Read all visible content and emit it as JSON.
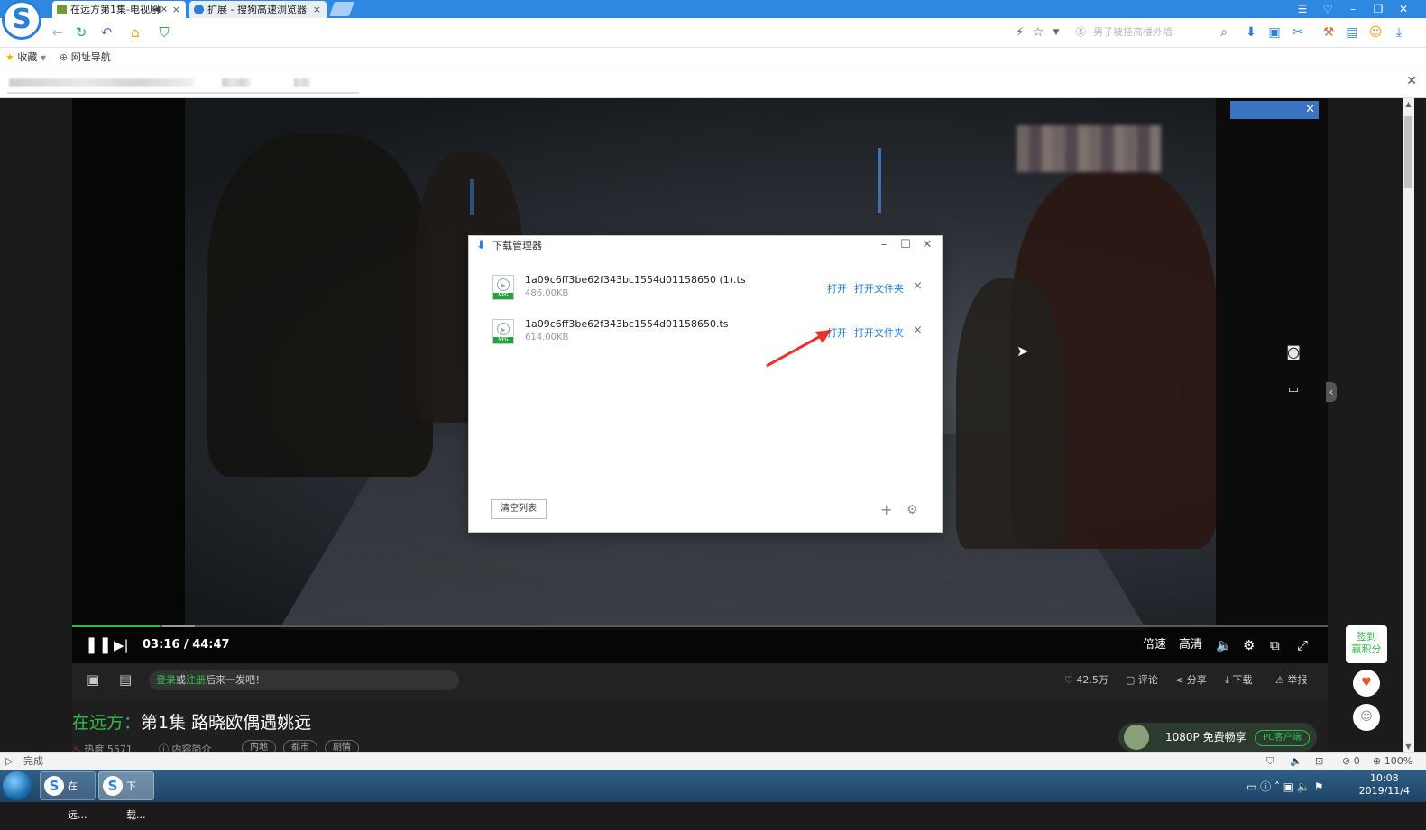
{
  "browser": {
    "logo_letter": "S",
    "tabs": [
      {
        "label": "在远方第1集-电视剧",
        "close": "×",
        "mute": "◀×"
      },
      {
        "label": "扩展 - 搜狗高速浏览器",
        "close": "×"
      }
    ],
    "window_controls": [
      "☰",
      "♡",
      "–",
      "❐",
      "✕"
    ],
    "address_placeholder": "男子被挂高楼外墙",
    "bookmarks": {
      "favorites": "收藏",
      "nav": "网址导航"
    },
    "infobar_close": "✕"
  },
  "video": {
    "ad_close": "✕",
    "progress_fraction": 0.07,
    "current_time": "03:16",
    "total_time": "44:47",
    "time_separator": "/",
    "controls": {
      "speed": "倍速",
      "quality": "高清"
    }
  },
  "toolbar": {
    "danmu_login": "登录",
    "danmu_or": "或",
    "danmu_register": "注册",
    "danmu_rest": "后来一发吧！",
    "likes": "42.5万",
    "comment": "评论",
    "share": "分享",
    "download": "下载",
    "report": "举报"
  },
  "show": {
    "series": "在远方",
    "sep": "：",
    "episode_title": "第1集 路晓欧偶遇姚远",
    "heat": "热度 5571",
    "intro": "内容简介",
    "tags": [
      "内地",
      "都市",
      "剧情"
    ],
    "promo": "1080P 免费畅享",
    "promo_button": "PC客户端"
  },
  "sidebar": {
    "sign_line1": "签到",
    "sign_line2": "赢积分"
  },
  "download_manager": {
    "title": "下载管理器",
    "items": [
      {
        "filename": "1a09c6ff3be62f343bc1554d01158650 (1).ts",
        "size": "486.00KB",
        "open": "打开",
        "open_folder": "打开文件夹",
        "remove": "×",
        "badge": "MPG"
      },
      {
        "filename": "1a09c6ff3be62f343bc1554d01158650.ts",
        "size": "614.00KB",
        "open": "打开",
        "open_folder": "打开文件夹",
        "remove": "×",
        "badge": "MPG"
      }
    ],
    "clear_list": "清空列表",
    "add": "+",
    "settings": "⚙"
  },
  "status": {
    "text": "完成",
    "zoom": "100%",
    "count": "0"
  },
  "taskbar": {
    "tasks": [
      {
        "label": "在远..."
      },
      {
        "label": "下载..."
      }
    ],
    "time": "10:08",
    "date": "2019/11/4"
  },
  "colors": {
    "accent_blue": "#2f88e0",
    "link_blue": "#1e7be0",
    "brand_green": "#2fbd4a",
    "arrow_red": "#e8322b"
  }
}
